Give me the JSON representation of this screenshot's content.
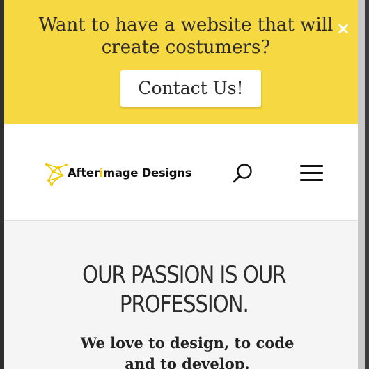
{
  "promo": {
    "message": "Want to have a website that will create costumers?",
    "button_label": "Contact Us!",
    "close_glyph": "×"
  },
  "header": {
    "logo": {
      "text_before": "After",
      "text_highlight": "i",
      "text_after": "mage Designs",
      "icon": "afterimage-logo-mark"
    },
    "search_icon": "search-icon",
    "menu_icon": "hamburger-menu-icon"
  },
  "hero": {
    "title": "OUR PASSION IS OUR PROFESSION.",
    "subtitle": "We love to design, to code and to develop."
  },
  "colors": {
    "promo_bg": "#f5d842",
    "accent": "#f5c800",
    "text": "#2b2b2b"
  }
}
